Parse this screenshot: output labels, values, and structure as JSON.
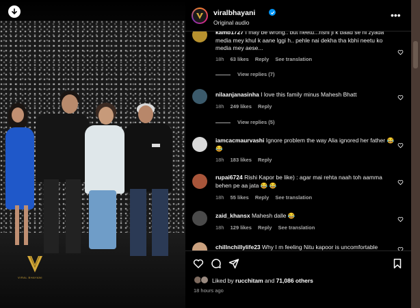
{
  "post": {
    "username": "viralbhayani",
    "audio": "Original audio",
    "more_label": "•••"
  },
  "comments": [
    {
      "user": "kamb1727",
      "text": "I may be wrong.. but neetu...rishi ji k baad se ni zyada media mey khul k aane lggi h.. pehle nai dekha tha kbhi neetu ko media mey aese...",
      "time": "18h",
      "likes": "63 likes",
      "reply": "Reply",
      "translation": "See translation",
      "view_replies": "View replies (7)"
    },
    {
      "user": "nilaanjanasinha",
      "text": "I love this family minus Mahesh Bhatt",
      "time": "18h",
      "likes": "249 likes",
      "reply": "Reply",
      "view_replies": "View replies (5)"
    },
    {
      "user": "iamcacmaurvashi",
      "text": "Ignore problem the way Alia ignored her father 😂 😂",
      "time": "18h",
      "likes": "183 likes",
      "reply": "Reply"
    },
    {
      "user": "rupai6724",
      "text": "Rishi Kapor be like) : agar mai rehta naah toh aamma behen pe aa jata 😂 😂",
      "time": "18h",
      "likes": "55 likes",
      "reply": "Reply",
      "translation": "See translation"
    },
    {
      "user": "zaid_khansx",
      "text": "Mahesh dalle 😂",
      "time": "18h",
      "likes": "129 likes",
      "reply": "Reply",
      "translation": "See translation"
    },
    {
      "user": "chillnchillylife23",
      "text": "Why I m feeling Nitu kapoor is uncomfortable"
    }
  ],
  "likes": {
    "prefix": "Liked by ",
    "user": "rucchitam",
    "middle": " and ",
    "count": "71,086 others"
  },
  "timestamp": "18 hours ago",
  "watermark": "VIRAL BHAYANI",
  "colors": {
    "accent": "#0095f6",
    "meta": "#a8a8a8",
    "bg": "#000000"
  }
}
